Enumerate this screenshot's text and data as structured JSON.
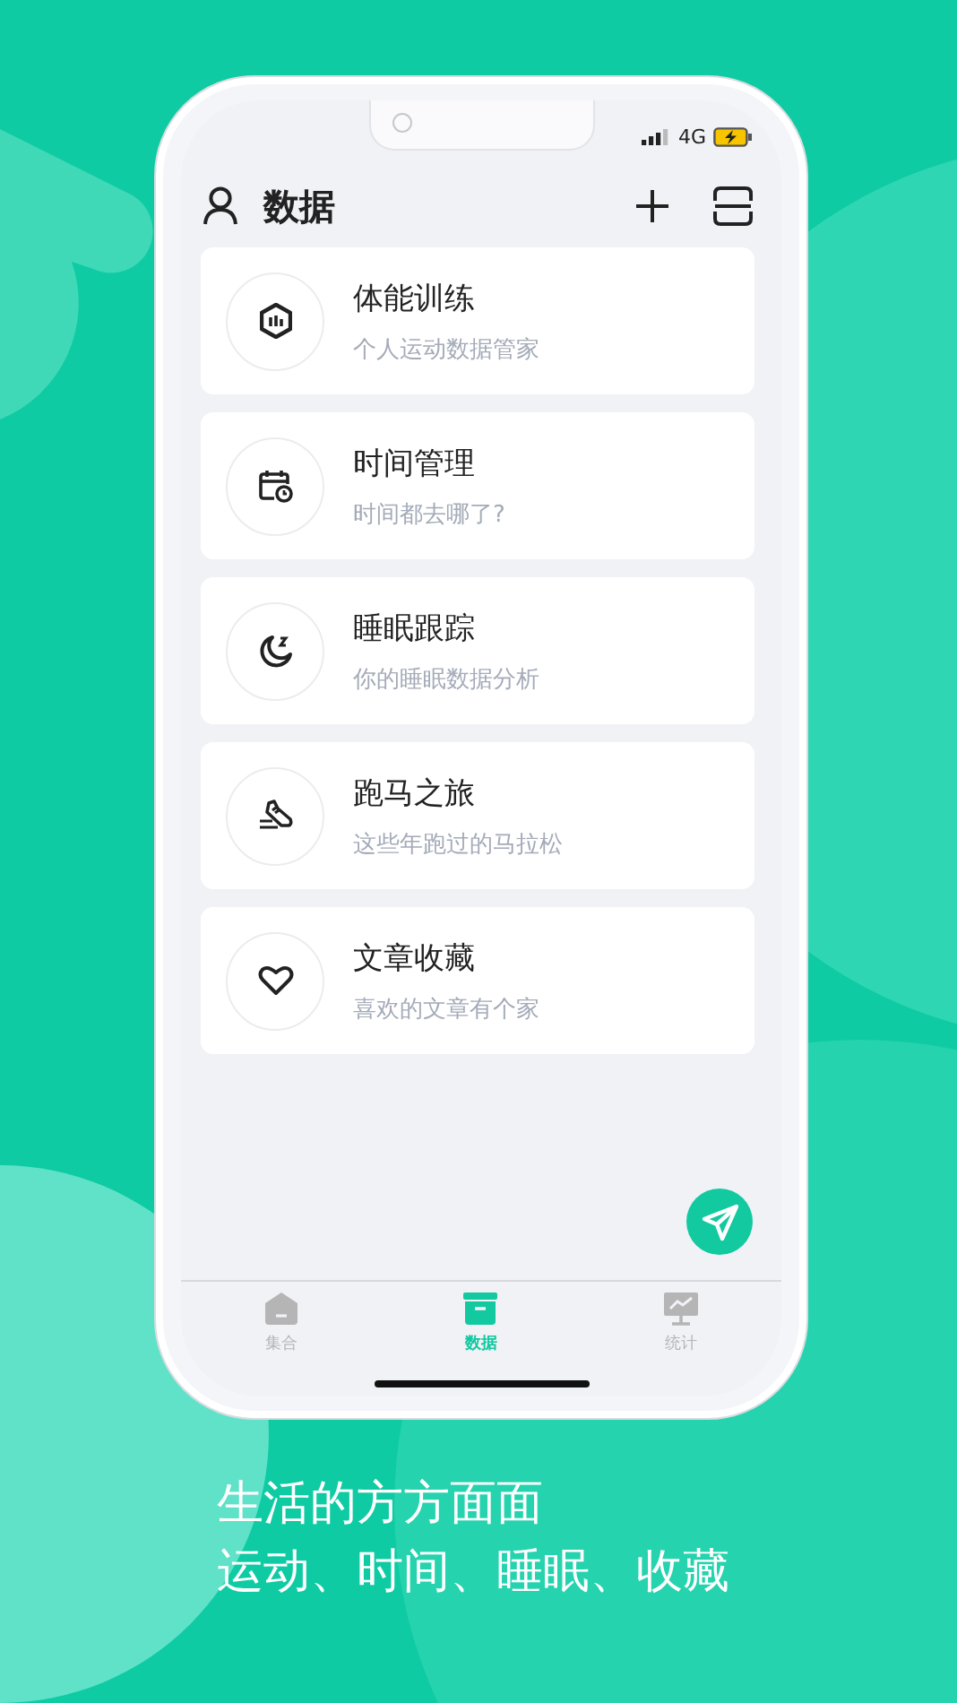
{
  "status_bar": {
    "network": "4G"
  },
  "header": {
    "title": "数据"
  },
  "items": [
    {
      "kind": "hexagon",
      "title": "体能训练",
      "subtitle": "个人运动数据管家"
    },
    {
      "kind": "calendar",
      "title": "时间管理",
      "subtitle": "时间都去哪了?"
    },
    {
      "kind": "moon",
      "title": "睡眠跟踪",
      "subtitle": "你的睡眠数据分析"
    },
    {
      "kind": "shoe",
      "title": "跑马之旅",
      "subtitle": "这些年跑过的马拉松"
    },
    {
      "kind": "heart",
      "title": "文章收藏",
      "subtitle": "喜欢的文章有个家"
    }
  ],
  "tabs": [
    {
      "kind": "house",
      "label": "集合",
      "selected": false
    },
    {
      "kind": "box",
      "label": "数据",
      "selected": true
    },
    {
      "kind": "monitor",
      "label": "统计",
      "selected": false
    }
  ],
  "tagline": [
    "生活的方方面面",
    "运动、时间、睡眠、收藏"
  ]
}
